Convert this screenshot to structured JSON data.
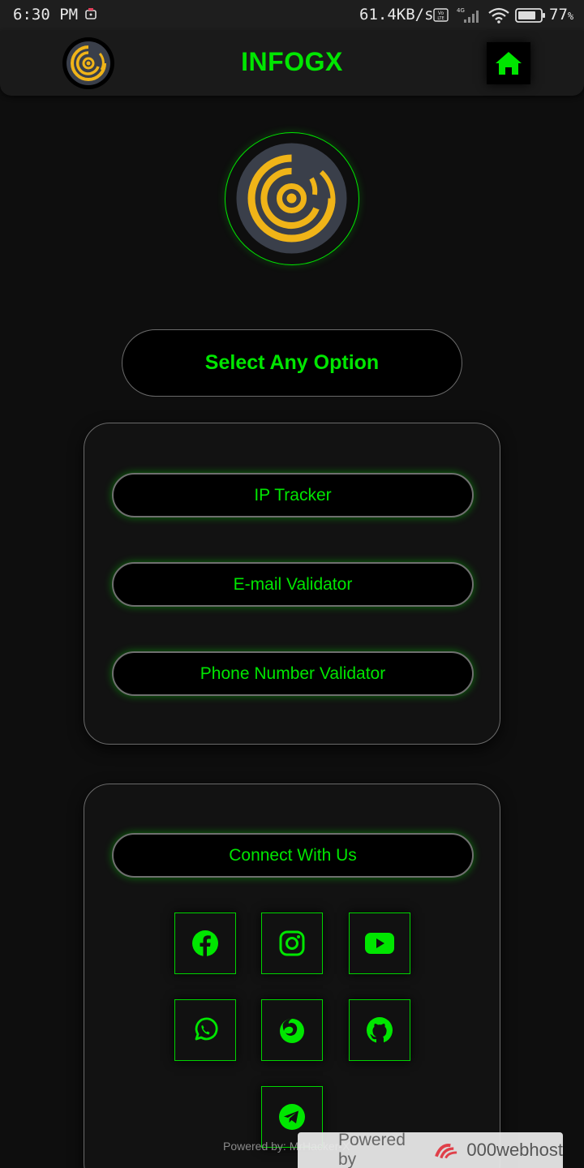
{
  "status_bar": {
    "time": "6:30 PM",
    "net_speed": "61.4KB/s",
    "battery_pct": "77",
    "battery_unit": "%"
  },
  "header": {
    "title": "INFOGX",
    "home_icon": "home-icon",
    "logo_icon": "target-logo-icon"
  },
  "hero": {
    "logo_icon": "target-logo-icon"
  },
  "select_label": "Select Any Option",
  "options": [
    {
      "label": "IP Tracker"
    },
    {
      "label": "E-mail Validator"
    },
    {
      "label": "Phone Number Validator"
    }
  ],
  "connect": {
    "label": "Connect With Us",
    "socials": [
      {
        "icon": "facebook-icon"
      },
      {
        "icon": "instagram-icon"
      },
      {
        "icon": "youtube-icon"
      },
      {
        "icon": "whatsapp-icon"
      },
      {
        "icon": "firefox-icon"
      },
      {
        "icon": "github-icon"
      },
      {
        "icon": "telegram-icon"
      }
    ]
  },
  "footer": {
    "powered_by": "Powered by: MrHacker-X",
    "host_prefix": "Powered by",
    "host_name": "000webhost"
  },
  "colors": {
    "accent": "#00e600",
    "background": "#0e0e0e",
    "logo_yellow": "#f0b418",
    "logo_bg": "#3a3f4a"
  }
}
